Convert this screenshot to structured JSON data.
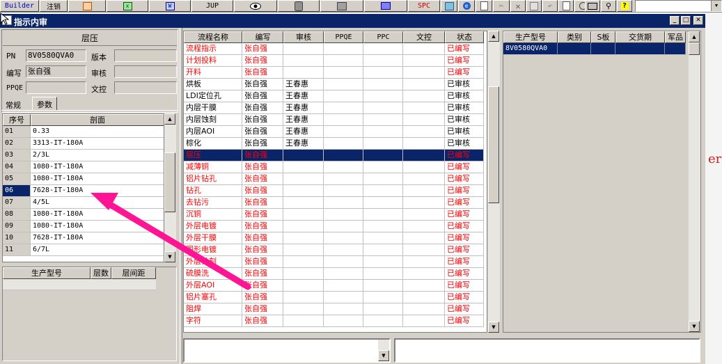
{
  "toolbar": {
    "builder_label": "Builder",
    "logout_label": "注销",
    "jup_label": "JUP",
    "spc_label": "SPC",
    "icons": [
      "ppt-icon",
      "excel-icon",
      "word-icon",
      "eye-icon",
      "database-icon",
      "network-icon",
      "computer-icon",
      "dialog-icon",
      "ie-icon",
      "new-doc-icon",
      "cut-icon",
      "delete-icon",
      "save-icon",
      "undo-icon",
      "preview-icon",
      "print-icon",
      "find-icon",
      "help-icon"
    ]
  },
  "window": {
    "title": "指示内审"
  },
  "left": {
    "section_title": "层压",
    "pn_label": "PN",
    "pn_value": "8V0580QVA0",
    "version_label": "版本",
    "version_value": "",
    "author_label": "编写",
    "author_value": "张自强",
    "review_label": "审核",
    "review_value": "",
    "ppqe_label": "PPQE",
    "ppqe_value": "",
    "doc_label": "文控",
    "doc_value": "",
    "tabs": [
      "常规",
      "参数"
    ],
    "param_headers": [
      "序号",
      "剖面"
    ],
    "param_rows": [
      {
        "no": "01",
        "val": "0.33"
      },
      {
        "no": "02",
        "val": "3313-IT-180A"
      },
      {
        "no": "03",
        "val": "2/3L"
      },
      {
        "no": "04",
        "val": "1080-IT-180A"
      },
      {
        "no": "05",
        "val": "1080-IT-180A"
      },
      {
        "no": "06",
        "val": "7628-IT-180A"
      },
      {
        "no": "07",
        "val": "4/5L"
      },
      {
        "no": "08",
        "val": "1080-IT-180A"
      },
      {
        "no": "09",
        "val": "1080-IT-180A"
      },
      {
        "no": "10",
        "val": "7628-IT-180A"
      },
      {
        "no": "11",
        "val": "6/7L"
      }
    ],
    "selected_param_no": "06",
    "bottom_headers": [
      "生产型号",
      "层数",
      "层间距"
    ]
  },
  "process": {
    "headers": [
      "流程名称",
      "编写",
      "审核",
      "PPQE",
      "PPC",
      "文控",
      "状态"
    ],
    "rows": [
      {
        "name": "流程指示",
        "author": "张自强",
        "reviewer": "",
        "status": "已编写"
      },
      {
        "name": "计划投料",
        "author": "张自强",
        "reviewer": "",
        "status": "已编写"
      },
      {
        "name": "开料",
        "author": "张自强",
        "reviewer": "",
        "status": "已编写"
      },
      {
        "name": "烘板",
        "author": "张自强",
        "reviewer": "王春惠",
        "status": "已审核"
      },
      {
        "name": "LDI定位孔",
        "author": "张自强",
        "reviewer": "王春惠",
        "status": "已审核"
      },
      {
        "name": "内层干膜",
        "author": "张自强",
        "reviewer": "王春惠",
        "status": "已审核"
      },
      {
        "name": "内层蚀刻",
        "author": "张自强",
        "reviewer": "王春惠",
        "status": "已审核"
      },
      {
        "name": "内层AOI",
        "author": "张自强",
        "reviewer": "王春惠",
        "status": "已审核"
      },
      {
        "name": "棕化",
        "author": "张自强",
        "reviewer": "王春惠",
        "status": "已审核"
      },
      {
        "name": "层压",
        "author": "张自强",
        "reviewer": "",
        "status": "已编写"
      },
      {
        "name": "减薄铜",
        "author": "张自强",
        "reviewer": "",
        "status": "已编写"
      },
      {
        "name": "铝片钻孔",
        "author": "张自强",
        "reviewer": "",
        "status": "已编写"
      },
      {
        "name": "钻孔",
        "author": "张自强",
        "reviewer": "",
        "status": "已编写"
      },
      {
        "name": "去钻污",
        "author": "张自强",
        "reviewer": "",
        "status": "已编写"
      },
      {
        "name": "沉铜",
        "author": "张自强",
        "reviewer": "",
        "status": "已编写"
      },
      {
        "name": "外层电镀",
        "author": "张自强",
        "reviewer": "",
        "status": "已编写"
      },
      {
        "name": "外层干膜",
        "author": "张自强",
        "reviewer": "",
        "status": "已编写"
      },
      {
        "name": "图形电镀",
        "author": "张自强",
        "reviewer": "",
        "status": "已编写"
      },
      {
        "name": "外层蚀刻",
        "author": "张自强",
        "reviewer": "",
        "status": "已编写"
      },
      {
        "name": "硫膜洗",
        "author": "张自强",
        "reviewer": "",
        "status": "已编写"
      },
      {
        "name": "外层AOI",
        "author": "张自强",
        "reviewer": "",
        "status": "已编写"
      },
      {
        "name": "铝片塞孔",
        "author": "张自强",
        "reviewer": "",
        "status": "已编写"
      },
      {
        "name": "阻焊",
        "author": "张自强",
        "reviewer": "",
        "status": "已编写"
      },
      {
        "name": "字符",
        "author": "张自强",
        "reviewer": "",
        "status": "已编写"
      }
    ],
    "selected_index": 9
  },
  "products": {
    "headers": [
      "生产型号",
      "类别",
      "S板",
      "交货期",
      "军品"
    ],
    "rows": [
      {
        "model": "8V0580QVA0",
        "type": "",
        "sboard": "",
        "delivery": "",
        "military": ""
      }
    ]
  },
  "colors": {
    "written_red": "#ff0000",
    "selection_navy": "#0a246a",
    "annotation_arrow": "#ff1493"
  },
  "background_text": "er"
}
